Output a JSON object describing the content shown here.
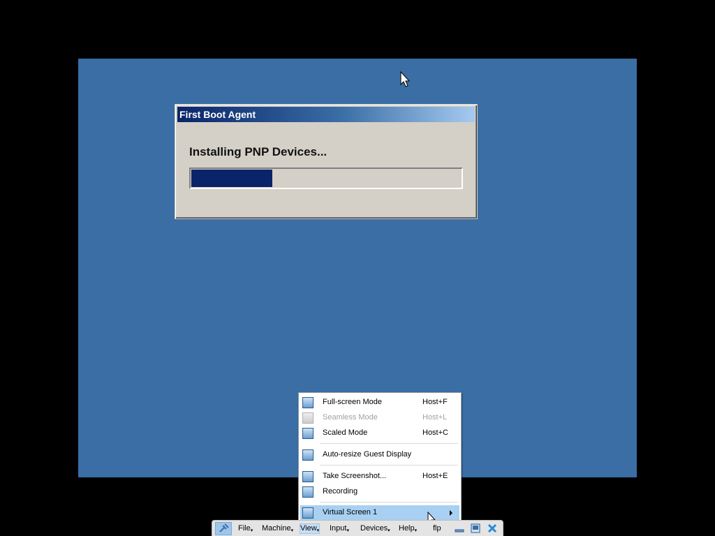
{
  "dialog": {
    "title": "First Boot Agent",
    "message": "Installing PNP Devices...",
    "progress_fraction": 0.3
  },
  "view_menu": {
    "items": [
      {
        "label": "Full-screen Mode",
        "shortcut": "Host+F",
        "enabled": true,
        "icon": "fullscreen-icon"
      },
      {
        "label": "Seamless Mode",
        "shortcut": "Host+L",
        "enabled": false,
        "icon": "seamless-icon"
      },
      {
        "label": "Scaled Mode",
        "shortcut": "Host+C",
        "enabled": true,
        "icon": "scaled-icon"
      },
      {
        "label": "Auto-resize Guest Display",
        "shortcut": "",
        "enabled": true,
        "icon": "auto-resize-icon"
      },
      {
        "label": "Take Screenshot...",
        "shortcut": "Host+E",
        "enabled": true,
        "icon": "screenshot-icon"
      },
      {
        "label": "Recording",
        "shortcut": "",
        "enabled": true,
        "icon": "recording-icon"
      },
      {
        "label": "Virtual Screen 1",
        "shortcut": "",
        "enabled": true,
        "icon": "virtual-screen-icon",
        "submenu": true,
        "highlighted": true
      }
    ]
  },
  "toolbar": {
    "menus": [
      "File",
      "Machine",
      "View",
      "Input",
      "Devices",
      "Help"
    ],
    "active_menu": "View",
    "vm_name": "flp"
  },
  "colors": {
    "desktop": "#3a6ea5",
    "title_gradient_start": "#0a246a",
    "progress_fill": "#0a246a",
    "menu_highlight": "#a8d0f2"
  }
}
